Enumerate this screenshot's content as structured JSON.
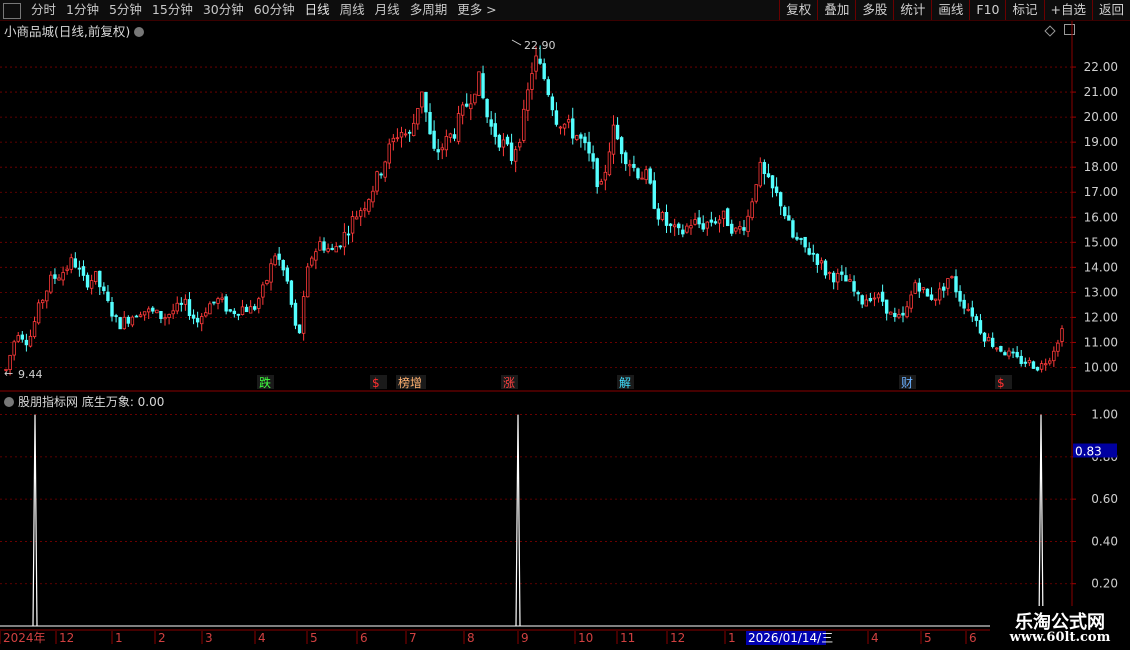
{
  "toolbar": {
    "periods": [
      "分时",
      "1分钟",
      "5分钟",
      "15分钟",
      "30分钟",
      "60分钟",
      "日线",
      "周线",
      "月线",
      "多周期",
      "更多 >"
    ],
    "active_period": "日线",
    "right_buttons": [
      "复权",
      "叠加",
      "多股",
      "统计",
      "画线",
      "F10",
      "标记",
      "+自选",
      "返回"
    ]
  },
  "main_title": "小商品城(日线,前复权)",
  "indicator_title": "股朋指标网  底生万象: 0.00",
  "indicator_cursor_value": "0.83",
  "date_highlight": "2026/01/14/三",
  "watermark": {
    "line1": "乐淘公式网",
    "line2": "www.60lt.com"
  },
  "chart_data": [
    {
      "type": "candlestick",
      "title": "小商品城(日线,前复权)",
      "y_ticks": [
        10.0,
        11.0,
        12.0,
        13.0,
        14.0,
        15.0,
        16.0,
        17.0,
        18.0,
        19.0,
        20.0,
        21.0,
        22.0
      ],
      "ylim": [
        9.3,
        23.2
      ],
      "high_label": "22.90",
      "low_label": "9.44",
      "grid": true,
      "up_color": "#ff3a3a",
      "down_color": "#54ffff",
      "close_path": [
        9.9,
        11.5,
        11.0,
        12.5,
        13.5,
        13.8,
        14.3,
        13.4,
        13.6,
        12.6,
        11.7,
        12.0,
        12.3,
        12.2,
        12.0,
        12.3,
        12.5,
        11.8,
        12.5,
        12.7,
        12.2,
        12.4,
        12.3,
        13.2,
        14.6,
        13.5,
        11.0,
        14.3,
        15.0,
        14.6,
        15.2,
        16.0,
        16.6,
        17.5,
        18.6,
        19.5,
        19.2,
        21.2,
        18.5,
        18.9,
        19.5,
        20.5,
        21.6,
        19.7,
        19.1,
        18.4,
        19.7,
        22.4,
        21.5,
        20.0,
        19.6,
        19.2,
        18.3,
        17.1,
        19.5,
        18.6,
        17.9,
        17.6,
        16.2,
        15.6,
        15.3,
        15.8,
        15.7,
        15.9,
        16.0,
        15.4,
        15.9,
        18.0,
        17.2,
        16.6,
        15.2,
        14.8,
        14.5,
        13.8,
        13.6,
        13.4,
        12.6,
        12.9,
        12.7,
        11.9,
        12.0,
        13.5,
        12.8,
        12.9,
        13.7,
        12.7,
        12.2,
        11.3,
        10.9,
        10.6,
        10.3,
        10.2,
        10.0,
        10.5,
        11.5
      ],
      "signals": [
        {
          "text": "跌",
          "color": "#40ff40"
        },
        {
          "text": "$",
          "color": "#ff3030"
        },
        {
          "text": "榜增",
          "color": "#ffb070"
        },
        {
          "text": "涨",
          "color": "#ff4040"
        },
        {
          "text": "解",
          "color": "#40e0ff"
        },
        {
          "text": "财",
          "color": "#6ab0ff"
        },
        {
          "text": "$",
          "color": "#ff3030"
        }
      ]
    },
    {
      "type": "line",
      "title": "股朋指标网  底生万象: 0.00",
      "y_ticks": [
        0.2,
        0.4,
        0.6,
        0.8,
        1.0
      ],
      "ylim": [
        0,
        1.05
      ],
      "spikes": [
        {
          "label": "2024-12 spike",
          "value": 1.0
        },
        {
          "label": "2025-09 spike",
          "value": 1.0
        },
        {
          "label": "2026-06 spike",
          "value": 1.0
        }
      ],
      "x_labels": [
        "2024年",
        "12",
        "1",
        "2",
        "3",
        "4",
        "5",
        "6",
        "7",
        "8",
        "9",
        "10",
        "11",
        "12",
        "1",
        "2026/01/14/三",
        "4",
        "5",
        "6"
      ]
    }
  ]
}
